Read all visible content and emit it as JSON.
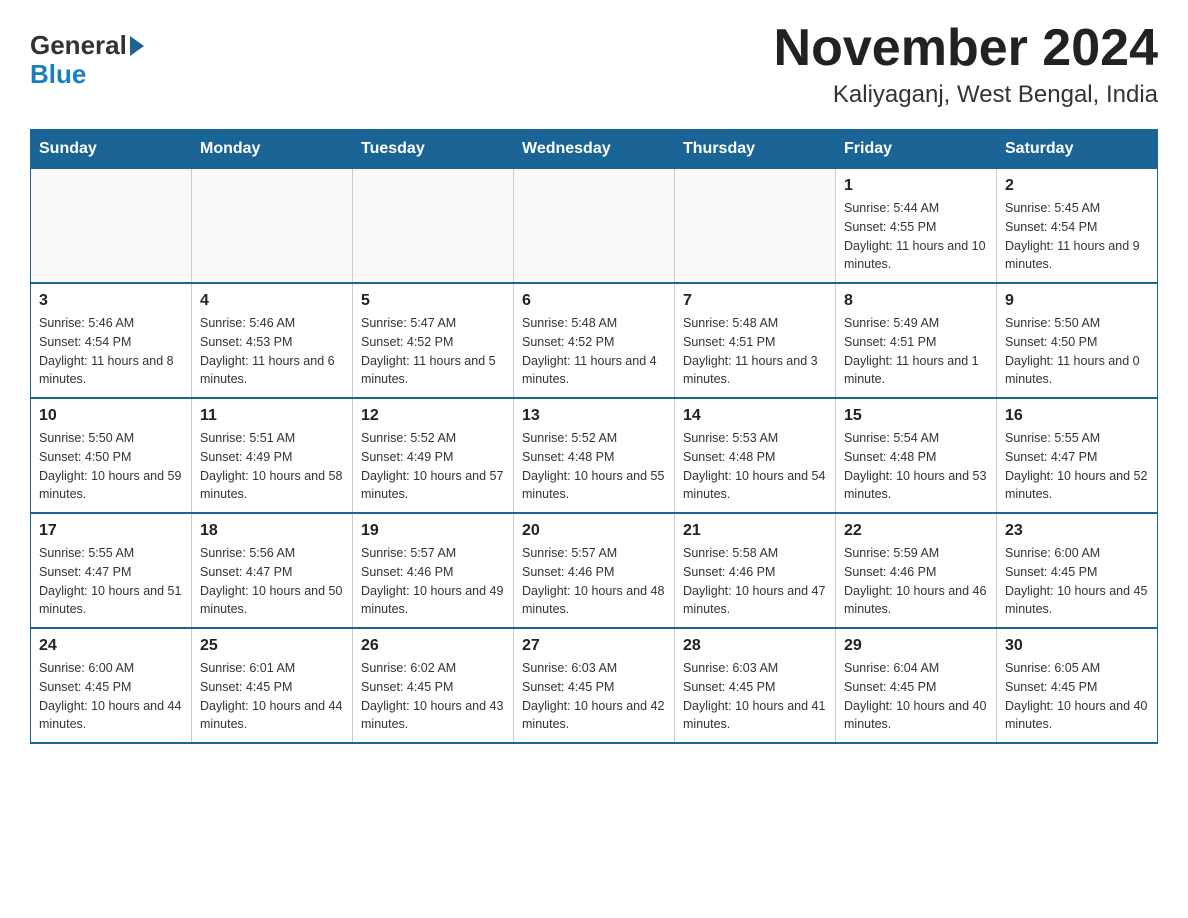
{
  "header": {
    "logo_general": "General",
    "logo_blue": "Blue",
    "title": "November 2024",
    "subtitle": "Kaliyaganj, West Bengal, India"
  },
  "weekdays": [
    "Sunday",
    "Monday",
    "Tuesday",
    "Wednesday",
    "Thursday",
    "Friday",
    "Saturday"
  ],
  "weeks": [
    [
      {
        "day": "",
        "info": ""
      },
      {
        "day": "",
        "info": ""
      },
      {
        "day": "",
        "info": ""
      },
      {
        "day": "",
        "info": ""
      },
      {
        "day": "",
        "info": ""
      },
      {
        "day": "1",
        "info": "Sunrise: 5:44 AM\nSunset: 4:55 PM\nDaylight: 11 hours and 10 minutes."
      },
      {
        "day": "2",
        "info": "Sunrise: 5:45 AM\nSunset: 4:54 PM\nDaylight: 11 hours and 9 minutes."
      }
    ],
    [
      {
        "day": "3",
        "info": "Sunrise: 5:46 AM\nSunset: 4:54 PM\nDaylight: 11 hours and 8 minutes."
      },
      {
        "day": "4",
        "info": "Sunrise: 5:46 AM\nSunset: 4:53 PM\nDaylight: 11 hours and 6 minutes."
      },
      {
        "day": "5",
        "info": "Sunrise: 5:47 AM\nSunset: 4:52 PM\nDaylight: 11 hours and 5 minutes."
      },
      {
        "day": "6",
        "info": "Sunrise: 5:48 AM\nSunset: 4:52 PM\nDaylight: 11 hours and 4 minutes."
      },
      {
        "day": "7",
        "info": "Sunrise: 5:48 AM\nSunset: 4:51 PM\nDaylight: 11 hours and 3 minutes."
      },
      {
        "day": "8",
        "info": "Sunrise: 5:49 AM\nSunset: 4:51 PM\nDaylight: 11 hours and 1 minute."
      },
      {
        "day": "9",
        "info": "Sunrise: 5:50 AM\nSunset: 4:50 PM\nDaylight: 11 hours and 0 minutes."
      }
    ],
    [
      {
        "day": "10",
        "info": "Sunrise: 5:50 AM\nSunset: 4:50 PM\nDaylight: 10 hours and 59 minutes."
      },
      {
        "day": "11",
        "info": "Sunrise: 5:51 AM\nSunset: 4:49 PM\nDaylight: 10 hours and 58 minutes."
      },
      {
        "day": "12",
        "info": "Sunrise: 5:52 AM\nSunset: 4:49 PM\nDaylight: 10 hours and 57 minutes."
      },
      {
        "day": "13",
        "info": "Sunrise: 5:52 AM\nSunset: 4:48 PM\nDaylight: 10 hours and 55 minutes."
      },
      {
        "day": "14",
        "info": "Sunrise: 5:53 AM\nSunset: 4:48 PM\nDaylight: 10 hours and 54 minutes."
      },
      {
        "day": "15",
        "info": "Sunrise: 5:54 AM\nSunset: 4:48 PM\nDaylight: 10 hours and 53 minutes."
      },
      {
        "day": "16",
        "info": "Sunrise: 5:55 AM\nSunset: 4:47 PM\nDaylight: 10 hours and 52 minutes."
      }
    ],
    [
      {
        "day": "17",
        "info": "Sunrise: 5:55 AM\nSunset: 4:47 PM\nDaylight: 10 hours and 51 minutes."
      },
      {
        "day": "18",
        "info": "Sunrise: 5:56 AM\nSunset: 4:47 PM\nDaylight: 10 hours and 50 minutes."
      },
      {
        "day": "19",
        "info": "Sunrise: 5:57 AM\nSunset: 4:46 PM\nDaylight: 10 hours and 49 minutes."
      },
      {
        "day": "20",
        "info": "Sunrise: 5:57 AM\nSunset: 4:46 PM\nDaylight: 10 hours and 48 minutes."
      },
      {
        "day": "21",
        "info": "Sunrise: 5:58 AM\nSunset: 4:46 PM\nDaylight: 10 hours and 47 minutes."
      },
      {
        "day": "22",
        "info": "Sunrise: 5:59 AM\nSunset: 4:46 PM\nDaylight: 10 hours and 46 minutes."
      },
      {
        "day": "23",
        "info": "Sunrise: 6:00 AM\nSunset: 4:45 PM\nDaylight: 10 hours and 45 minutes."
      }
    ],
    [
      {
        "day": "24",
        "info": "Sunrise: 6:00 AM\nSunset: 4:45 PM\nDaylight: 10 hours and 44 minutes."
      },
      {
        "day": "25",
        "info": "Sunrise: 6:01 AM\nSunset: 4:45 PM\nDaylight: 10 hours and 44 minutes."
      },
      {
        "day": "26",
        "info": "Sunrise: 6:02 AM\nSunset: 4:45 PM\nDaylight: 10 hours and 43 minutes."
      },
      {
        "day": "27",
        "info": "Sunrise: 6:03 AM\nSunset: 4:45 PM\nDaylight: 10 hours and 42 minutes."
      },
      {
        "day": "28",
        "info": "Sunrise: 6:03 AM\nSunset: 4:45 PM\nDaylight: 10 hours and 41 minutes."
      },
      {
        "day": "29",
        "info": "Sunrise: 6:04 AM\nSunset: 4:45 PM\nDaylight: 10 hours and 40 minutes."
      },
      {
        "day": "30",
        "info": "Sunrise: 6:05 AM\nSunset: 4:45 PM\nDaylight: 10 hours and 40 minutes."
      }
    ]
  ]
}
